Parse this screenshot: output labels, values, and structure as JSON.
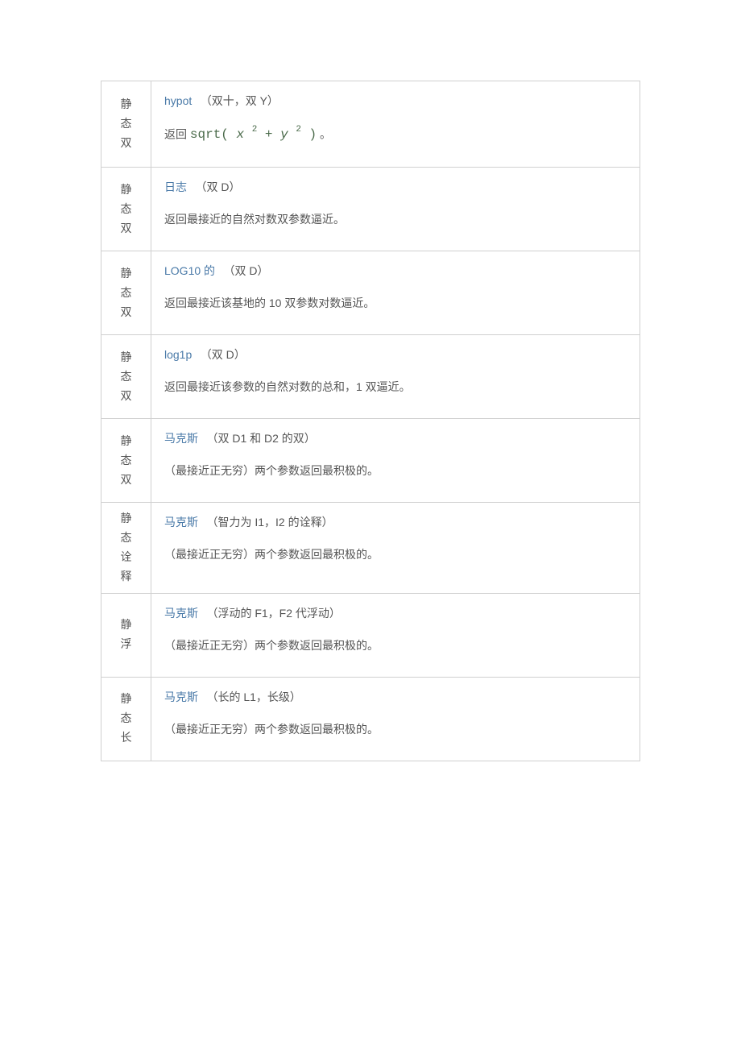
{
  "rows": [
    {
      "modifier": [
        "静",
        "态",
        "双"
      ],
      "method": "hypot",
      "params": "（双十，双 Y）",
      "descriptionPrefix": "返回 ",
      "codeFormula": true
    },
    {
      "modifier": [
        "静",
        "态",
        "双"
      ],
      "method": "日志",
      "params": "（双 D）",
      "description": "返回最接近的自然对数双参数逼近。"
    },
    {
      "modifier": [
        "静",
        "态",
        "双"
      ],
      "method": "LOG10 的",
      "params": "（双 D）",
      "description": "返回最接近该基地的 10 双参数对数逼近。"
    },
    {
      "modifier": [
        "静",
        "态",
        "双"
      ],
      "method": "log1p",
      "params": "（双 D）",
      "description": "返回最接近该参数的自然对数的总和，1 双逼近。"
    },
    {
      "modifier": [
        "静",
        "态",
        "双"
      ],
      "method": "马克斯",
      "params": "（双 D1 和 D2 的双）",
      "description": "（最接近正无穷）两个参数返回最积极的。"
    },
    {
      "modifier": [
        "静",
        "态",
        "诠",
        "释"
      ],
      "method": "马克斯",
      "params": "（智力为 I1，I2 的诠释）",
      "description": "（最接近正无穷）两个参数返回最积极的。"
    },
    {
      "modifier": [
        "静",
        "浮"
      ],
      "method": "马克斯",
      "params": "（浮动的 F1，F2 代浮动）",
      "description": "（最接近正无穷）两个参数返回最积极的。"
    },
    {
      "modifier": [
        "静",
        "态",
        "长"
      ],
      "method": "马克斯",
      "params": "（长的 L1，长级）",
      "description": "（最接近正无穷）两个参数返回最积极的。"
    }
  ],
  "formula": {
    "sqrt": "sqrt(",
    "x": " x ",
    "exp1": "2",
    "plus": " + ",
    "y": "y ",
    "exp2": "2",
    "close": " )",
    "period": " 。"
  }
}
